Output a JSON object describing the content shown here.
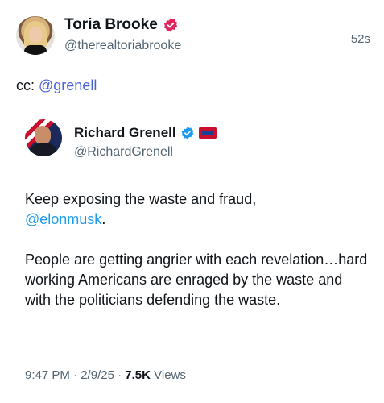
{
  "post": {
    "author_name": "Toria Brooke",
    "author_handle": "@therealtoriabrooke",
    "timestamp": "52s",
    "text_prefix": "cc: ",
    "mention": "@grenell"
  },
  "quoted_post": {
    "author_name": "Richard Grenell",
    "author_handle": "@RichardGrenell",
    "line1_text": "Keep exposing the waste and fraud,",
    "mention": "@elonmusk",
    "mention_suffix": ".",
    "paragraph2": "People are getting angrier with each revelation…hard working Americans are enraged by the waste and with the politicians defending the waste.",
    "time": "9:47 PM",
    "separator1": " · ",
    "date": "2/9/25",
    "separator2": " · ",
    "views_count": "7.5K",
    "views_label": " Views"
  },
  "colors": {
    "verified_red": "#e0245e",
    "verified_blue": "#1d9bf0",
    "mention_purple": "#4b63d8",
    "mention_blue": "#1d9bf0",
    "secondary_text": "#536471"
  },
  "icons": [
    "verified-badge-red-icon",
    "verified-badge-blue-icon",
    "affiliation-badge-icon"
  ]
}
